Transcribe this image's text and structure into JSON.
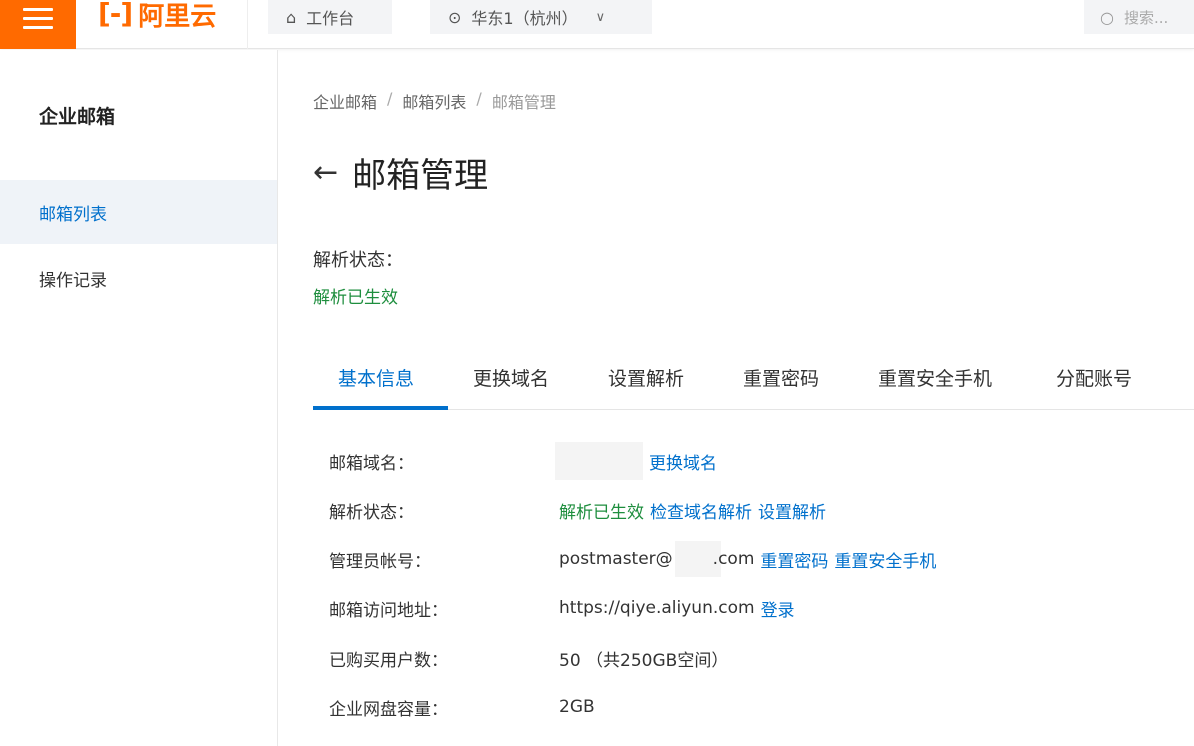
{
  "topbar": {
    "brand": "阿里云",
    "brand_mark": "[-]",
    "workbench": "工作台",
    "region": "华东1（杭州）",
    "search_placeholder": "搜索..."
  },
  "sidebar": {
    "title": "企业邮箱",
    "items": [
      {
        "label": "邮箱列表",
        "active": true
      },
      {
        "label": "操作记录",
        "active": false
      }
    ]
  },
  "breadcrumb": [
    "企业邮箱",
    "邮箱列表",
    "邮箱管理"
  ],
  "page": {
    "title": "邮箱管理",
    "status_label": "解析状态：",
    "status_value": "解析已生效"
  },
  "tabs": [
    "基本信息",
    "更换域名",
    "设置解析",
    "重置密码",
    "重置安全手机",
    "分配账号"
  ],
  "info": {
    "domain": {
      "label": "邮箱域名：",
      "link": "更换域名"
    },
    "resolve": {
      "label": "解析状态：",
      "status": "解析已生效",
      "link1": "检查域名解析",
      "link2": "设置解析"
    },
    "admin": {
      "label": "管理员帐号：",
      "prefix": "postmaster@",
      "suffix": ".com",
      "link1": "重置密码",
      "link2": "重置安全手机"
    },
    "access": {
      "label": "邮箱访问地址：",
      "url": "https://qiye.aliyun.com",
      "link": "登录"
    },
    "users": {
      "label": "已购买用户数：",
      "value": "50 （共250GB空间）"
    },
    "disk": {
      "label": "企业网盘容量：",
      "value": "2GB"
    }
  },
  "colors": {
    "brand": "#ff6a00",
    "link": "#0070cc",
    "success": "#1e8e3e"
  }
}
